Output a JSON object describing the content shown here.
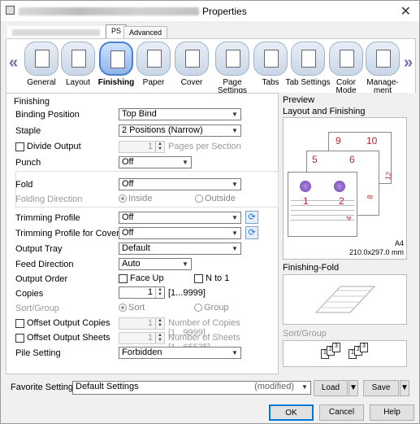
{
  "window": {
    "title": "Properties",
    "close_glyph": "✕"
  },
  "top_tabs": [
    {
      "label": "PS"
    },
    {
      "label": "Advanced"
    }
  ],
  "ribbon": {
    "prev_glyph": "«",
    "next_glyph": "»",
    "items": [
      {
        "label": "General",
        "icon": "printer-icon",
        "active": false
      },
      {
        "label": "Layout",
        "icon": "layout-icon",
        "active": false
      },
      {
        "label": "Finishing",
        "icon": "finishing-icon",
        "active": true
      },
      {
        "label": "Paper",
        "icon": "paper-icon",
        "active": false
      },
      {
        "label": "Cover",
        "icon": "cover-icon",
        "active": false
      },
      {
        "label": "Page Settings",
        "icon": "page-settings-icon",
        "active": false
      },
      {
        "label": "Tabs",
        "icon": "tabs-icon",
        "active": false
      },
      {
        "label": "Tab Settings",
        "icon": "tab-settings-icon",
        "active": false
      },
      {
        "label": "Color Mode",
        "icon": "color-mode-icon",
        "active": false
      },
      {
        "label": "Manage-ment",
        "icon": "management-icon",
        "active": false
      }
    ]
  },
  "finishing": {
    "section_label": "Finishing",
    "binding_position": {
      "label": "Binding Position",
      "value": "Top Bind"
    },
    "staple": {
      "label": "Staple",
      "value": "2 Positions (Narrow)"
    },
    "divide_output": {
      "label": "Divide Output",
      "value": "1",
      "hint": "Pages per Section"
    },
    "punch": {
      "label": "Punch",
      "value": "Off"
    },
    "fold": {
      "label": "Fold",
      "value": "Off"
    },
    "folding_direction": {
      "label": "Folding Direction",
      "opt1": "Inside",
      "opt2": "Outside"
    },
    "trimming_profile": {
      "label": "Trimming Profile",
      "value": "Off"
    },
    "trimming_profile_cover": {
      "label": "Trimming Profile for Cover",
      "value": "Off"
    },
    "output_tray": {
      "label": "Output Tray",
      "value": "Default"
    },
    "feed_direction": {
      "label": "Feed Direction",
      "value": "Auto"
    },
    "output_order": {
      "label": "Output Order",
      "opt1": "Face Up",
      "opt2": "N to 1"
    },
    "copies": {
      "label": "Copies",
      "value": "1",
      "hint": "[1...9999]"
    },
    "sort_group": {
      "label": "Sort/Group",
      "opt1": "Sort",
      "opt2": "Group"
    },
    "offset_output_copies": {
      "label": "Offset Output Copies",
      "value": "1",
      "hint": "Number of Copies [1...9999]"
    },
    "offset_output_sheets": {
      "label": "Offset Output Sheets",
      "value": "1",
      "hint": "Number of Sheets [1...65535]"
    },
    "pile_setting": {
      "label": "Pile Setting",
      "value": "Forbidden"
    }
  },
  "preview": {
    "label": "Preview",
    "layout_label": "Layout and Finishing",
    "paper_size": "A4",
    "paper_dims": "210.0x297.0 mm",
    "page_numbers": [
      "9",
      "10",
      "5",
      "6",
      "1",
      "2",
      "12",
      "8",
      "4"
    ],
    "finishing_fold_label": "Finishing-Fold",
    "sort_group_label": "Sort/Group",
    "sort_numbers": [
      "1",
      "2",
      "3",
      "1",
      "2",
      "3"
    ]
  },
  "footer": {
    "favorite_label": "Favorite Setting",
    "favorite_value": "Default Settings",
    "favorite_modified": "(modified)",
    "load": "Load",
    "save": "Save",
    "ok": "OK",
    "cancel": "Cancel",
    "help": "Help"
  },
  "colors": {
    "accent": "#0078d7",
    "page_number": "#c0272d",
    "ribbon_arrow": "#6b6bb0"
  }
}
